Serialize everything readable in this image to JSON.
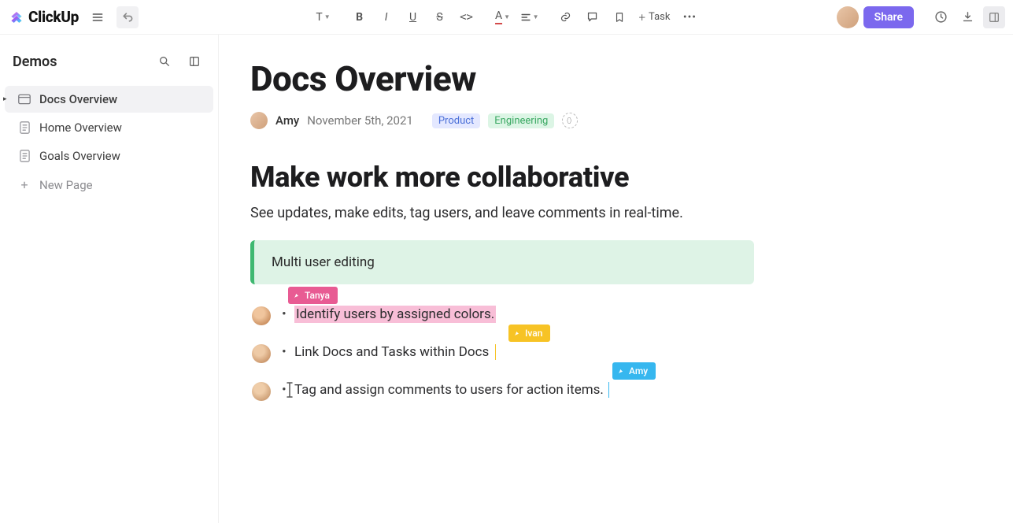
{
  "app": {
    "name": "ClickUp"
  },
  "toolbar": {
    "task_label": "Task"
  },
  "header": {
    "share_label": "Share"
  },
  "sidebar": {
    "workspace": "Demos",
    "items": [
      {
        "label": "Docs Overview",
        "active": true
      },
      {
        "label": "Home Overview",
        "active": false
      },
      {
        "label": "Goals Overview",
        "active": false
      }
    ],
    "new_label": "New Page"
  },
  "doc": {
    "title": "Docs Overview",
    "author": "Amy",
    "date": "November 5th, 2021",
    "tags": [
      {
        "label": "Product",
        "style": "product"
      },
      {
        "label": "Engineering",
        "style": "engineering"
      }
    ],
    "heading": "Make work more collaborative",
    "paragraph": "See updates, make edits, tag users, and leave comments in real-time.",
    "callout": "Multi user editing",
    "bullets": [
      {
        "text": "Identify users by assigned colors.",
        "highlight": "pink",
        "user_flag": {
          "name": "Tanya",
          "color": "pink"
        }
      },
      {
        "text": "Link Docs and Tasks within Docs",
        "highlight": null,
        "user_flag": {
          "name": "Ivan",
          "color": "yellow"
        }
      },
      {
        "text": "Tag and assign comments to users for action items.",
        "highlight": null,
        "user_flag": {
          "name": "Amy",
          "color": "blue"
        }
      }
    ]
  }
}
